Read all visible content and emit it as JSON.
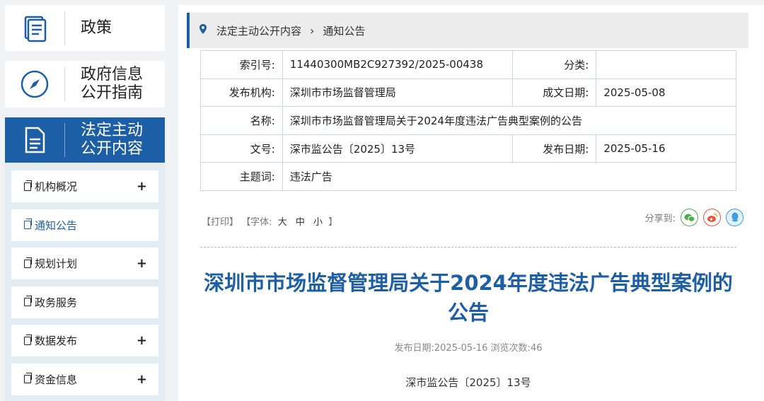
{
  "sidebar": {
    "top": [
      {
        "label": "政策",
        "icon": "document-stack-icon"
      },
      {
        "label": "政府信息公开指南",
        "line1": "政府信息",
        "line2": "公开指南",
        "icon": "compass-icon"
      },
      {
        "label": "法定主动公开内容",
        "line1": "法定主动",
        "line2": "公开内容",
        "icon": "document-icon"
      }
    ],
    "items": [
      {
        "label": "机构概况",
        "expand": "+"
      },
      {
        "label": "通知公告",
        "expand": ""
      },
      {
        "label": "规划计划",
        "expand": "+"
      },
      {
        "label": "政务服务",
        "expand": ""
      },
      {
        "label": "数据发布",
        "expand": "+"
      },
      {
        "label": "资金信息",
        "expand": "+"
      }
    ]
  },
  "breadcrumb": {
    "root": "法定主动公开内容",
    "current": "通知公告"
  },
  "meta": {
    "index_label": "索引号:",
    "index_value": "11440300MB2C927392/2025-00438",
    "category_label": "分类:",
    "category_value": "",
    "publisher_label": "发布机构:",
    "publisher_value": "深圳市市场监督管理局",
    "created_label": "成文日期:",
    "created_value": "2025-05-08",
    "name_label": "名称:",
    "name_value": "深圳市市场监督管理局关于2024年度违法广告典型案例的公告",
    "docno_label": "文号:",
    "docno_value": "深市监公告〔2025〕13号",
    "published_label": "发布日期:",
    "published_value": "2025-05-16",
    "topic_label": "主题词:",
    "topic_value": "违法广告"
  },
  "tools": {
    "print": "【打印】",
    "font_prefix": "【字体:",
    "large": "大",
    "medium": "中",
    "small": "小",
    "font_suffix": "】"
  },
  "share": {
    "label": "分享到:"
  },
  "article": {
    "title": "深圳市市场监督管理局关于2024年度违法广告典型案例的公告",
    "pub_info": "发布日期:2025-05-16   浏览次数:46",
    "doc_no": "深市监公告〔2025〕13号"
  },
  "colors": {
    "accent": "#1d5fa6",
    "wechat": "#4caf50",
    "weibo": "#e8553d",
    "qq": "#3d9ee0"
  }
}
